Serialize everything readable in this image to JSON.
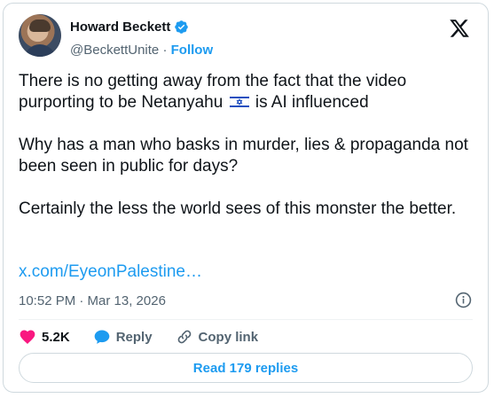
{
  "author": {
    "name": "Howard Beckett",
    "handle": "@BeckettUnite",
    "separator": " · ",
    "follow_label": "Follow"
  },
  "tweet": {
    "paragraph1_part1": "There is no getting away from the fact that the video purporting to be Netanyahu ",
    "paragraph1_part2": " is AI influenced",
    "paragraph2": "Why has a man who basks in murder, lies & propaganda not been seen in public for days?",
    "paragraph3": "Certainly the less the world sees of this monster the better.",
    "link": "x.com/EyeonPalestine…",
    "timestamp": "10:52 PM · Mar 13, 2026"
  },
  "actions": {
    "likes_count": "5.2K",
    "reply_label": "Reply",
    "copy_link_label": "Copy link"
  },
  "read_replies_label": "Read 179 replies",
  "colors": {
    "accent": "#1d9bf0",
    "like": "#f91880",
    "text": "#0f1419",
    "muted": "#536471"
  }
}
